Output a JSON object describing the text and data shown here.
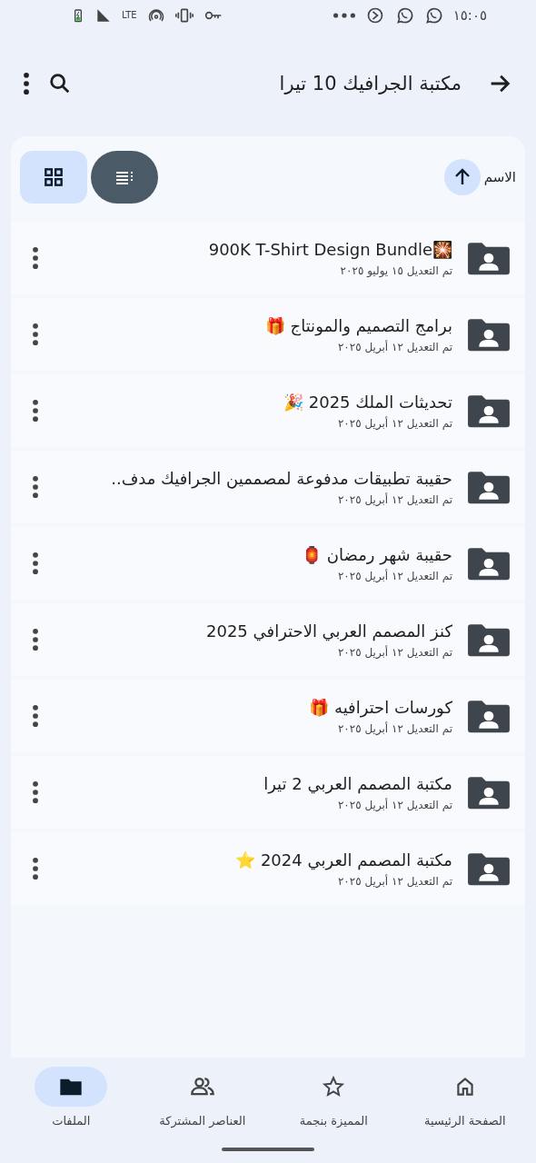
{
  "status_bar": {
    "network": "LTE",
    "time": "١٥:٠٥"
  },
  "header": {
    "title": "مكتبة الجرافيك 10 تيرا"
  },
  "sort": {
    "label": "الاسم"
  },
  "view_modes": [
    {
      "kind": "list",
      "selected": true
    },
    {
      "kind": "grid",
      "selected": false
    }
  ],
  "files": [
    {
      "name": "900K T-Shirt Design Bundle🎇",
      "modified": "تم التعديل ١٥ يوليو ٢٠٢٥"
    },
    {
      "name": "برامج التصميم والمونتاج 🎁",
      "modified": "تم التعديل ١٢ أبريل ٢٠٢٥"
    },
    {
      "name": "تحديثات الملك 2025 🎉",
      "modified": "تم التعديل ١٢ أبريل ٢٠٢٥"
    },
    {
      "name": "حقيبة تطبيقات مدفوعة لمصممين الجرافيك مدف..",
      "modified": "تم التعديل ١٢ أبريل ٢٠٢٥"
    },
    {
      "name": "حقيبة شهر رمضان 🏮",
      "modified": "تم التعديل ١٢ أبريل ٢٠٢٥"
    },
    {
      "name": "كنز المصمم العربي الاحترافي 2025",
      "modified": "تم التعديل ١٢ أبريل ٢٠٢٥"
    },
    {
      "name": "كورسات احترافيه 🎁",
      "modified": "تم التعديل ١٢ أبريل ٢٠٢٥"
    },
    {
      "name": "مكتبة المصمم العربي 2 تيرا",
      "modified": "تم التعديل ١٢ أبريل ٢٠٢٥"
    },
    {
      "name": "مكتبة المصمم العربي 2024 ⭐",
      "modified": "تم التعديل ١٢ أبريل ٢٠٢٥"
    }
  ],
  "bottom_nav": [
    {
      "kind": "home",
      "label": "الصفحة الرئيسية",
      "selected": false
    },
    {
      "kind": "starred",
      "label": "المميزة بنجمة",
      "selected": false
    },
    {
      "kind": "shared",
      "label": "العناصر المشتركة",
      "selected": false
    },
    {
      "kind": "files",
      "label": "الملفات",
      "selected": true
    }
  ]
}
